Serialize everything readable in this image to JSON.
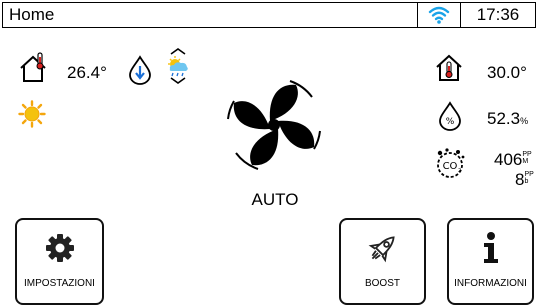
{
  "status_bar": {
    "title": "Home",
    "time": "17:36"
  },
  "indoor": {
    "temperature": "26.4°"
  },
  "outdoor": {
    "temperature": "30.0°",
    "humidity": "52.3",
    "humidity_unit": "%",
    "co2_value": "406",
    "co2_unit_top": "PP",
    "co2_unit_bottom": "M",
    "voc_value": "8",
    "voc_unit_top": "PP",
    "voc_unit_bottom": "b"
  },
  "fan": {
    "mode": "AUTO"
  },
  "buttons": {
    "settings": "IMPOSTAZIONI",
    "boost": "BOOST",
    "info": "INFORMAZIONI"
  },
  "colors": {
    "wifi": "#1aa3e8",
    "sun": "#f4c20d",
    "drop_blue": "#1a6fd6",
    "temp_red": "#d6201f"
  }
}
